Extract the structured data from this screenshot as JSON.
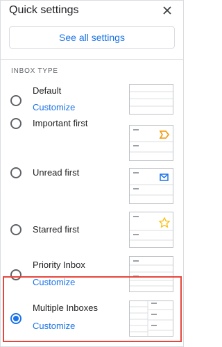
{
  "header": {
    "title": "Quick settings",
    "close_icon": "close-icon"
  },
  "see_all_label": "See all settings",
  "section_label": "INBOX TYPE",
  "options": [
    {
      "label": "Default",
      "link": "Customize",
      "selected": false,
      "thumb": "default"
    },
    {
      "label": "Important first",
      "link": "",
      "selected": false,
      "thumb": "important-icon"
    },
    {
      "label": "Unread first",
      "link": "",
      "selected": false,
      "thumb": "mail-icon"
    },
    {
      "label": "Starred first",
      "link": "",
      "selected": false,
      "thumb": "star-icon"
    },
    {
      "label": "Priority Inbox",
      "link": "Customize",
      "selected": false,
      "thumb": "priority"
    },
    {
      "label": "Multiple Inboxes",
      "link": "Customize",
      "selected": true,
      "thumb": "multiple"
    }
  ],
  "colors": {
    "accent": "#1a73e8",
    "important": "#f29900",
    "star": "#fbbc04",
    "highlight": "#e8453c"
  }
}
